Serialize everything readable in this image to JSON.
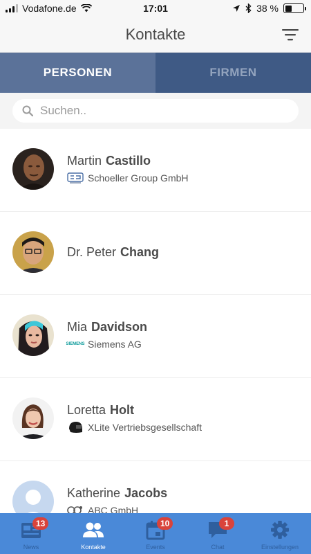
{
  "status_bar": {
    "carrier": "Vodafone.de",
    "time": "17:01",
    "battery_percent": "38 %",
    "battery_level": 0.38
  },
  "nav": {
    "title": "Kontakte",
    "filter_icon": "filter-icon"
  },
  "segments": {
    "persons": "PERSONEN",
    "companies": "FIRMEN",
    "active": "persons"
  },
  "search": {
    "placeholder": "Suchen.."
  },
  "contacts": [
    {
      "first": "Martin",
      "last": "Castillo",
      "company": "Schoeller Group GmbH",
      "logo": "schoeller-logo"
    },
    {
      "first": "Dr. Peter",
      "last": "Chang",
      "company": "",
      "logo": ""
    },
    {
      "first": "Mia",
      "last": "Davidson",
      "company": "Siemens AG",
      "logo": "siemens-logo",
      "logo_text": "SIEMENS"
    },
    {
      "first": "Loretta",
      "last": "Holt",
      "company": "XLite Vertriebsgesellschaft",
      "logo": "helmet-logo"
    },
    {
      "first": "Katherine",
      "last": "Jacobs",
      "company": "ABC GmbH",
      "logo": "abc-logo"
    }
  ],
  "tab_bar": {
    "items": [
      {
        "label": "News",
        "icon": "news-icon",
        "badge": "13"
      },
      {
        "label": "Kontakte",
        "icon": "contacts-icon",
        "badge": ""
      },
      {
        "label": "Events",
        "icon": "calendar-icon",
        "badge": "10"
      },
      {
        "label": "Chat",
        "icon": "chat-icon",
        "badge": "1"
      },
      {
        "label": "Einstellungen",
        "icon": "gear-icon",
        "badge": ""
      }
    ],
    "active": "Kontakte"
  },
  "colors": {
    "segment_active": "#5b7299",
    "segment_inactive": "#3f5a85",
    "tab_bar": "#4a89d8",
    "badge": "#d9433b"
  }
}
